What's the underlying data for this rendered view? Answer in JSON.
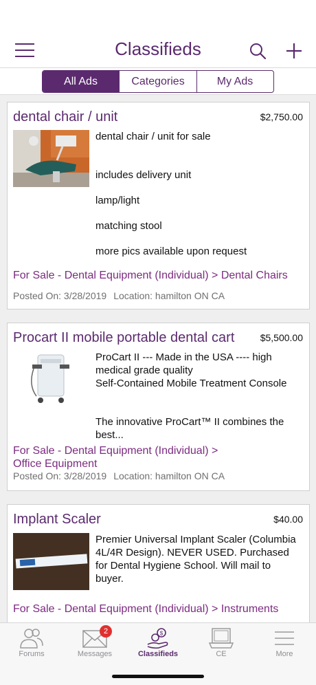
{
  "header": {
    "title": "Classifieds",
    "menu_icon": "hamburger-menu-icon",
    "search_icon": "search-icon",
    "add_icon": "plus-icon"
  },
  "segments": [
    {
      "label": "All Ads",
      "active": true
    },
    {
      "label": "Categories",
      "active": false
    },
    {
      "label": "My Ads",
      "active": false
    }
  ],
  "ads": [
    {
      "title": "dental chair / unit",
      "price": "$2,750.00",
      "description": [
        "dental chair / unit for sale",
        "",
        "includes delivery unit",
        "",
        "lamp/light",
        "",
        "matching stool",
        "",
        "more pics available upon request"
      ],
      "category": "For Sale - Dental Equipment (Individual) > Dental Chairs",
      "posted": "Posted On: 3/28/2019",
      "location": "Location: hamilton ON CA"
    },
    {
      "title": "Procart II mobile portable dental cart",
      "price": "$5,500.00",
      "description": [
        "ProCart II --- Made in the USA ---- high medical grade quality",
        "Self-Contained Mobile Treatment Console",
        "",
        "The innovative ProCart™ II combines the best..."
      ],
      "category_line1": "For Sale - Dental Equipment (Individual) >",
      "category_line2": "Office Equipment",
      "posted": "Posted On: 3/28/2019",
      "location": "Location: hamilton ON CA"
    },
    {
      "title": "Implant Scaler",
      "price": "$40.00",
      "description": [
        "Premier Universal Implant Scaler (Columbia 4L/4R Design). NEVER USED. Purchased for Dental Hygiene School. Will mail to buyer."
      ],
      "category": "For Sale - Dental Equipment (Individual) > Instruments"
    }
  ],
  "tabbar": [
    {
      "label": "Forums",
      "icon": "people-icon"
    },
    {
      "label": "Messages",
      "icon": "envelope-icon",
      "badge": "2"
    },
    {
      "label": "Classifieds",
      "icon": "hand-coins-icon",
      "active": true
    },
    {
      "label": "CE",
      "icon": "laptop-icon"
    },
    {
      "label": "More",
      "icon": "menu-lines-icon"
    }
  ],
  "colors": {
    "brand": "#5b2a6e",
    "category": "#7b2b80",
    "badge": "#e0302f"
  }
}
